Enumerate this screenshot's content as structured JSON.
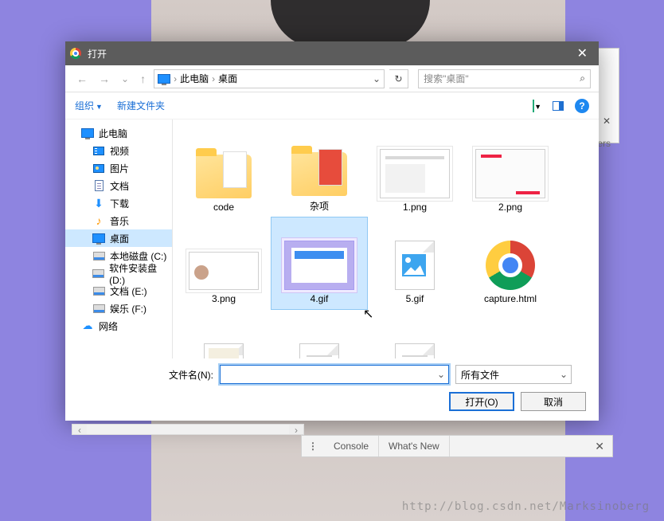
{
  "dialog": {
    "title": "打开",
    "close_x": "✕",
    "nav": {
      "back": "←",
      "fwd": "→",
      "up": "↑",
      "refresh": "↻",
      "crumb1": "此电脑",
      "crumb2": "桌面",
      "sep": "›",
      "chev": "⌄"
    },
    "search_placeholder": "搜索\"桌面\"",
    "search_icon": "⌕",
    "toolbar": {
      "organize": "组织",
      "newfolder": "新建文件夹",
      "help": "?"
    },
    "tree": [
      {
        "label": "此电脑",
        "icon": "mon",
        "lvl": 0
      },
      {
        "label": "视频",
        "icon": "video",
        "lvl": 1
      },
      {
        "label": "图片",
        "icon": "pic",
        "lvl": 1
      },
      {
        "label": "文档",
        "icon": "doc",
        "lvl": 1
      },
      {
        "label": "下载",
        "icon": "dl",
        "lvl": 1
      },
      {
        "label": "音乐",
        "icon": "music",
        "lvl": 1
      },
      {
        "label": "桌面",
        "icon": "mon",
        "lvl": 1,
        "sel": true
      },
      {
        "label": "本地磁盘 (C:)",
        "icon": "disk",
        "lvl": 1
      },
      {
        "label": "软件安装盘 (D:)",
        "icon": "disk",
        "lvl": 1
      },
      {
        "label": "文档 (E:)",
        "icon": "disk",
        "lvl": 1
      },
      {
        "label": "娱乐 (F:)",
        "icon": "disk",
        "lvl": 1
      },
      {
        "label": "网络",
        "icon": "net",
        "lvl": 0
      }
    ],
    "files": [
      {
        "label": "code",
        "kind": "folder"
      },
      {
        "label": "杂项",
        "kind": "folder-red"
      },
      {
        "label": "1.png",
        "kind": "thumb1"
      },
      {
        "label": "2.png",
        "kind": "thumb2"
      },
      {
        "label": "3.png",
        "kind": "thumb3"
      },
      {
        "label": "4.gif",
        "kind": "thumb4",
        "sel": true
      },
      {
        "label": "5.gif",
        "kind": "page-pic"
      },
      {
        "label": "capture.html",
        "kind": "chrome"
      },
      {
        "label": "",
        "kind": "page-map"
      },
      {
        "label": "",
        "kind": "page-lines"
      },
      {
        "label": "",
        "kind": "page-lines"
      }
    ],
    "filename_label": "文件名(N):",
    "filename_value": "",
    "filter_value": "所有文件",
    "open_btn": "打开(O)",
    "cancel_btn": "取消"
  },
  "back_window": {
    "ers": "ers",
    "x": "✕"
  },
  "devtools": {
    "menu": "⋮",
    "tab1": "Console",
    "tab2": "What's New",
    "x": "✕"
  },
  "watermark": "http://blog.csdn.net/Marksinoberg"
}
